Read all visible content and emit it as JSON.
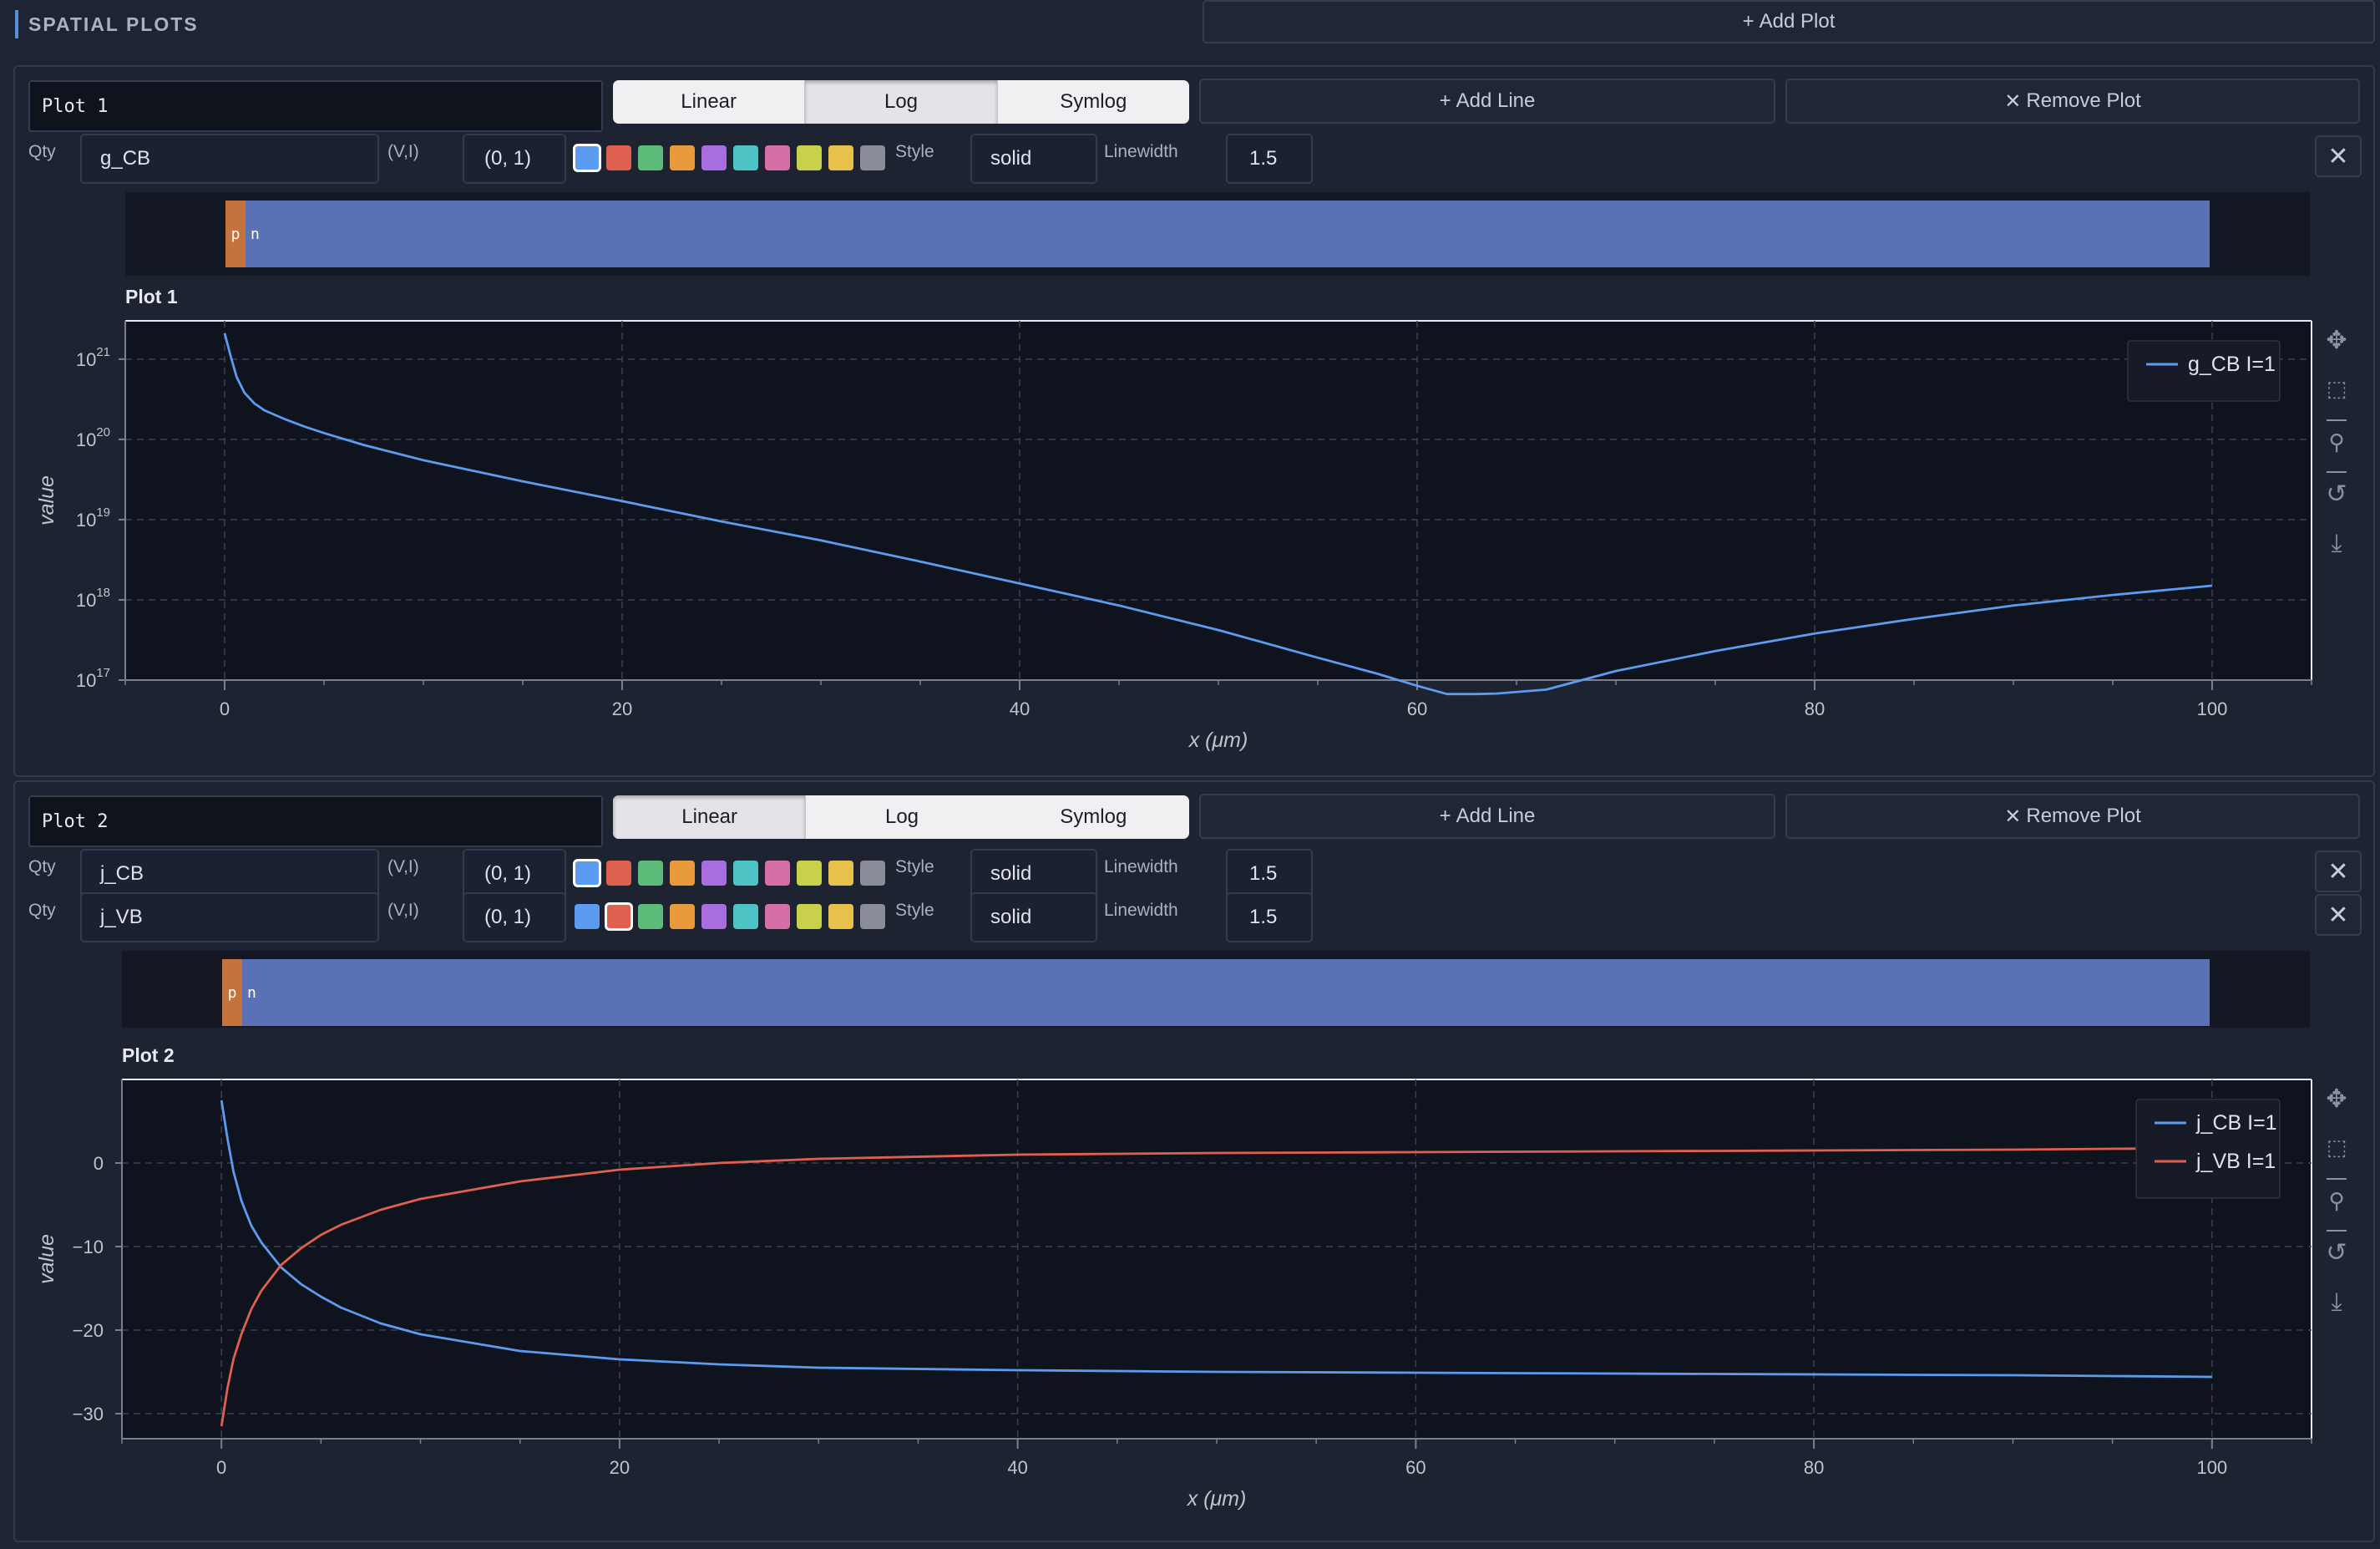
{
  "header": {
    "title": "SPATIAL PLOTS",
    "add_plot_label": "Add Plot"
  },
  "colors": {
    "palette": [
      "#5b9cf0",
      "#e0604f",
      "#5dbb7a",
      "#e89a3c",
      "#a86ee0",
      "#4ec3c5",
      "#d66ea8",
      "#c7d14c",
      "#e8c14a",
      "#8a8d98"
    ],
    "p_region": "#c4733c",
    "n_region": "#5b71b5"
  },
  "plots": [
    {
      "name": "Plot 1",
      "title": "Plot 1",
      "scale_options": [
        "Linear",
        "Log",
        "Symlog"
      ],
      "active_scale": "Log",
      "add_line_label": "Add Line",
      "remove_plot_label": "Remove Plot",
      "lines": [
        {
          "qty_label": "Qty",
          "qty": "g_CB",
          "vi_label": "(V,I)",
          "vi": "(0, 1)",
          "style_label": "Style",
          "style": "solid",
          "linewidth_label": "Linewidth",
          "linewidth": "1.5",
          "selected_color": 0
        }
      ],
      "band": {
        "p": "p",
        "n": "n"
      }
    },
    {
      "name": "Plot 2",
      "title": "Plot 2",
      "scale_options": [
        "Linear",
        "Log",
        "Symlog"
      ],
      "active_scale": "Linear",
      "add_line_label": "Add Line",
      "remove_plot_label": "Remove Plot",
      "lines": [
        {
          "qty_label": "Qty",
          "qty": "j_CB",
          "vi_label": "(V,I)",
          "vi": "(0, 1)",
          "style_label": "Style",
          "style": "solid",
          "linewidth_label": "Linewidth",
          "linewidth": "1.5",
          "selected_color": 0
        },
        {
          "qty_label": "Qty",
          "qty": "j_VB",
          "vi_label": "(V,I)",
          "vi": "(0, 1)",
          "style_label": "Style",
          "style": "solid",
          "linewidth_label": "Linewidth",
          "linewidth": "1.5",
          "selected_color": 1
        }
      ],
      "band": {
        "p": "p",
        "n": "n"
      }
    }
  ],
  "chart_data": [
    {
      "type": "line",
      "title": "Plot 1",
      "xlabel": "x (μm)",
      "ylabel": "value",
      "yscale": "log",
      "xlim": [
        -5,
        105
      ],
      "ylim": [
        1e+17,
        3e+21
      ],
      "xticks": [
        0,
        20,
        40,
        60,
        80,
        100
      ],
      "yticks": [
        17,
        18,
        19,
        20,
        21
      ],
      "ytick_base": "10",
      "grid": true,
      "legend": "top-right",
      "series": [
        {
          "name": "g_CB I=1",
          "color": "#5b9cf0",
          "x": [
            0,
            0.3,
            0.6,
            1,
            1.5,
            2,
            3,
            4,
            5,
            7,
            10,
            15,
            20,
            25,
            30,
            35,
            40,
            45,
            50,
            55,
            58,
            60,
            61.5,
            63,
            64,
            66.5,
            70,
            75,
            80,
            85,
            90,
            95,
            100
          ],
          "y": [
            2.1e+21,
            1.1e+21,
            6e+20,
            3.8e+20,
            2.8e+20,
            2.3e+20,
            1.8e+20,
            1.45e+20,
            1.2e+20,
            8.5e+19,
            5.5e+19,
            3e+19,
            1.7e+19,
            9.5e+18,
            5.5e+18,
            3e+18,
            1.6e+18,
            8.5e+17,
            4.2e+17,
            1.9e+17,
            1.2e+17,
            8.5e+16,
            6.7e+16,
            6.7e+16,
            6.8e+16,
            7.6e+16,
            1.3e+17,
            2.3e+17,
            3.8e+17,
            5.8e+17,
            8.5e+17,
            1.15e+18,
            1.5e+18
          ]
        }
      ]
    },
    {
      "type": "line",
      "title": "Plot 2",
      "xlabel": "x (μm)",
      "ylabel": "value",
      "yscale": "linear",
      "xlim": [
        -5,
        105
      ],
      "ylim": [
        -33,
        10
      ],
      "xticks": [
        0,
        20,
        40,
        60,
        80,
        100
      ],
      "yticks": [
        0,
        -10,
        -20,
        -30
      ],
      "grid": true,
      "legend": "top-right",
      "series": [
        {
          "name": "j_CB I=1",
          "color": "#5b9cf0",
          "x": [
            0,
            0.3,
            0.6,
            1,
            1.5,
            2,
            3,
            4,
            5,
            6,
            8,
            10,
            15,
            20,
            25,
            30,
            40,
            50,
            60,
            70,
            80,
            90,
            100
          ],
          "y": [
            7.5,
            3,
            -1,
            -4.5,
            -7.5,
            -9.5,
            -12.5,
            -14.5,
            -16,
            -17.3,
            -19.2,
            -20.5,
            -22.5,
            -23.5,
            -24.1,
            -24.5,
            -24.8,
            -25,
            -25.1,
            -25.2,
            -25.3,
            -25.4,
            -25.6
          ]
        },
        {
          "name": "j_VB I=1",
          "color": "#e0604f",
          "x": [
            0,
            0.3,
            0.6,
            1,
            1.5,
            2,
            3,
            4,
            5,
            6,
            8,
            10,
            15,
            20,
            25,
            30,
            40,
            50,
            60,
            70,
            80,
            90,
            100
          ],
          "y": [
            -31.5,
            -27,
            -23.5,
            -20.5,
            -17.5,
            -15.3,
            -12.2,
            -10.2,
            -8.6,
            -7.4,
            -5.6,
            -4.3,
            -2.2,
            -0.8,
            0,
            0.5,
            1,
            1.2,
            1.3,
            1.4,
            1.5,
            1.6,
            1.8
          ]
        }
      ]
    }
  ]
}
